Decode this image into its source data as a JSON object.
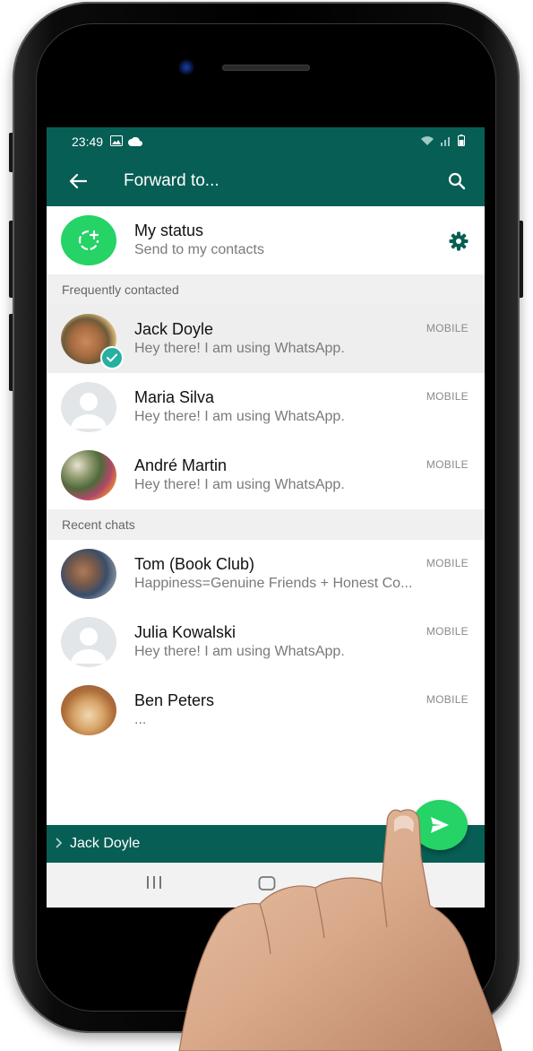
{
  "status_bar": {
    "time": "23:49"
  },
  "app_bar": {
    "title": "Forward to..."
  },
  "my_status": {
    "name": "My status",
    "subtitle": "Send to my contacts"
  },
  "sections": {
    "frequent": "Frequently contacted",
    "recent": "Recent chats"
  },
  "frequent_contacts": [
    {
      "name": "Jack Doyle",
      "status": "Hey there! I am using WhatsApp.",
      "label": "MOBILE",
      "selected": true
    },
    {
      "name": "Maria Silva",
      "status": "Hey there! I am using WhatsApp.",
      "label": "MOBILE",
      "selected": false
    },
    {
      "name": "André Martin",
      "status": "Hey there! I am using WhatsApp.",
      "label": "MOBILE",
      "selected": false
    }
  ],
  "recent_chats": [
    {
      "name": "Tom (Book Club)",
      "status": "Happiness=Genuine Friends + Honest Co...",
      "label": "MOBILE"
    },
    {
      "name": "Julia Kowalski",
      "status": "Hey there! I am using WhatsApp.",
      "label": "MOBILE"
    },
    {
      "name": "Ben Peters",
      "status": "...",
      "label": "MOBILE"
    }
  ],
  "footer": {
    "selected_names": "Jack Doyle"
  },
  "colors": {
    "header": "#075e54",
    "accent": "#25d366",
    "check": "#25b0a0"
  },
  "icons": {
    "back": "arrow-left-icon",
    "search": "search-icon",
    "settings": "gear-icon",
    "send": "send-icon"
  }
}
